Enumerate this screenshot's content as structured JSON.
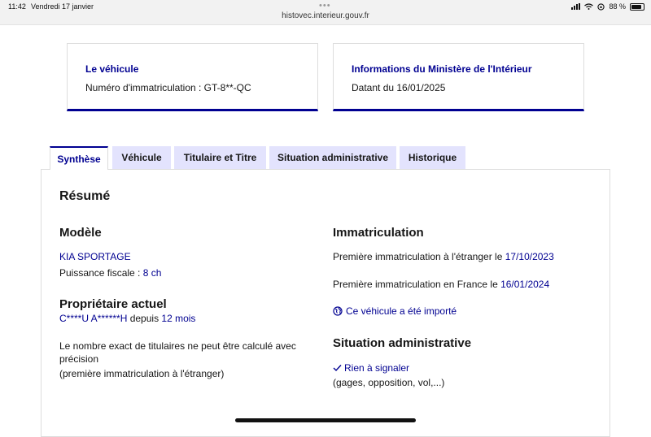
{
  "status_bar": {
    "time": "11:42",
    "date": "Vendredi 17 janvier",
    "url": "histovec.interieur.gouv.fr",
    "battery": "88 %"
  },
  "cards": {
    "vehicle": {
      "title": "Le véhicule",
      "label": "Numéro d'immatriculation : ",
      "value": "GT-8**-QC"
    },
    "ministry": {
      "title": "Informations du Ministère de l'Intérieur",
      "label": "Datant du ",
      "value": "16/01/2025"
    }
  },
  "tabs": [
    "Synthèse",
    "Véhicule",
    "Titulaire et Titre",
    "Situation administrative",
    "Historique"
  ],
  "summary": {
    "title": "Résumé",
    "model": {
      "heading": "Modèle",
      "name": "KIA SPORTAGE",
      "power_label": "Puissance fiscale : ",
      "power_value": "8 ch"
    },
    "owner": {
      "heading": "Propriétaire actuel",
      "name": "C****U A******H",
      "since_label": " depuis ",
      "since_value": "12 mois",
      "note_line1": "Le nombre exact de titulaires ne peut être calculé avec",
      "note_line2": "précision",
      "note_line3": "(première immatriculation à l'étranger)"
    },
    "registration": {
      "heading": "Immatriculation",
      "foreign_label": "Première immatriculation à l'étranger le ",
      "foreign_date": "17/10/2023",
      "france_label": "Première immatriculation en France le ",
      "france_date": "16/01/2024",
      "imported": "Ce véhicule a été importé"
    },
    "admin": {
      "heading": "Situation administrative",
      "status": "Rien à signaler",
      "detail": "(gages, opposition, vol,...)"
    }
  },
  "colors": {
    "primary": "#000091",
    "tab_bg": "#e3e3fd",
    "border": "#dddddd"
  }
}
